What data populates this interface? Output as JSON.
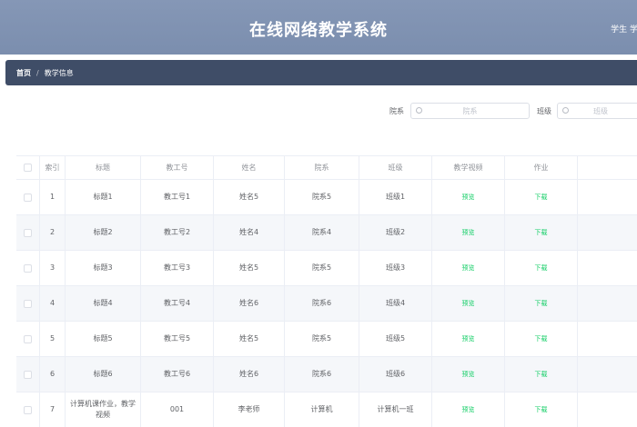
{
  "header": {
    "title": "在线网络教学系统",
    "user": "学生 学生"
  },
  "breadcrumb": {
    "home": "首页",
    "separator": "/",
    "current": "教学信息"
  },
  "filters": {
    "department": {
      "label": "院系",
      "placeholder": "院系"
    },
    "class": {
      "label": "班级",
      "placeholder": "班级"
    }
  },
  "table": {
    "columns": [
      "索引",
      "标题",
      "教工号",
      "姓名",
      "院系",
      "班级",
      "教学视频",
      "作业"
    ],
    "rows": [
      {
        "index": "1",
        "title": "标题1",
        "staff_no": "教工号1",
        "name": "姓名5",
        "dept": "院系5",
        "class": "班级1",
        "video": "预览",
        "homework": "下载"
      },
      {
        "index": "2",
        "title": "标题2",
        "staff_no": "教工号2",
        "name": "姓名4",
        "dept": "院系4",
        "class": "班级2",
        "video": "预览",
        "homework": "下载"
      },
      {
        "index": "3",
        "title": "标题3",
        "staff_no": "教工号3",
        "name": "姓名5",
        "dept": "院系5",
        "class": "班级3",
        "video": "预览",
        "homework": "下载"
      },
      {
        "index": "4",
        "title": "标题4",
        "staff_no": "教工号4",
        "name": "姓名6",
        "dept": "院系6",
        "class": "班级4",
        "video": "预览",
        "homework": "下载"
      },
      {
        "index": "5",
        "title": "标题5",
        "staff_no": "教工号5",
        "name": "姓名5",
        "dept": "院系5",
        "class": "班级5",
        "video": "预览",
        "homework": "下载"
      },
      {
        "index": "6",
        "title": "标题6",
        "staff_no": "教工号6",
        "name": "姓名6",
        "dept": "院系6",
        "class": "班级6",
        "video": "预览",
        "homework": "下载"
      },
      {
        "index": "7",
        "title": "计算机课作业，教学视频",
        "staff_no": "001",
        "name": "李老师",
        "dept": "计算机",
        "class": "计算机一班",
        "video": "预览",
        "homework": "下载"
      }
    ]
  },
  "colors": {
    "header_bg": "#8597b6",
    "breadcrumb_bg": "#3f4d67",
    "link": "#13ce66",
    "stripe": "#f5f7fa"
  }
}
